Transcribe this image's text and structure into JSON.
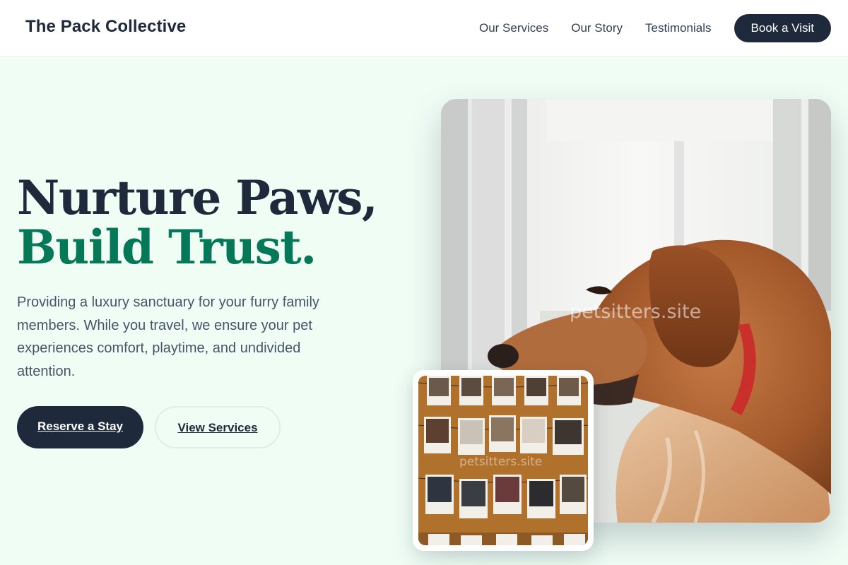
{
  "header": {
    "brand": "The Pack Collective",
    "nav": [
      {
        "label": "Our Services"
      },
      {
        "label": "Our Story"
      },
      {
        "label": "Testimonials"
      }
    ],
    "cta_label": "Book a Visit"
  },
  "hero": {
    "headline_line1": "Nurture Paws,",
    "headline_line2": "Build Trust.",
    "description": "Providing a luxury sanctuary for your furry family members. While you travel, we ensure your pet experiences comfort, playtime, and undivided attention.",
    "primary_button": "Reserve a Stay",
    "secondary_button": "View Services"
  },
  "images": {
    "main_watermark": "petsitters.site",
    "thumb_watermark": "petsitters.site"
  },
  "colors": {
    "navy": "#1e293b",
    "green": "#047857",
    "hero_bg": "#effdf5"
  }
}
